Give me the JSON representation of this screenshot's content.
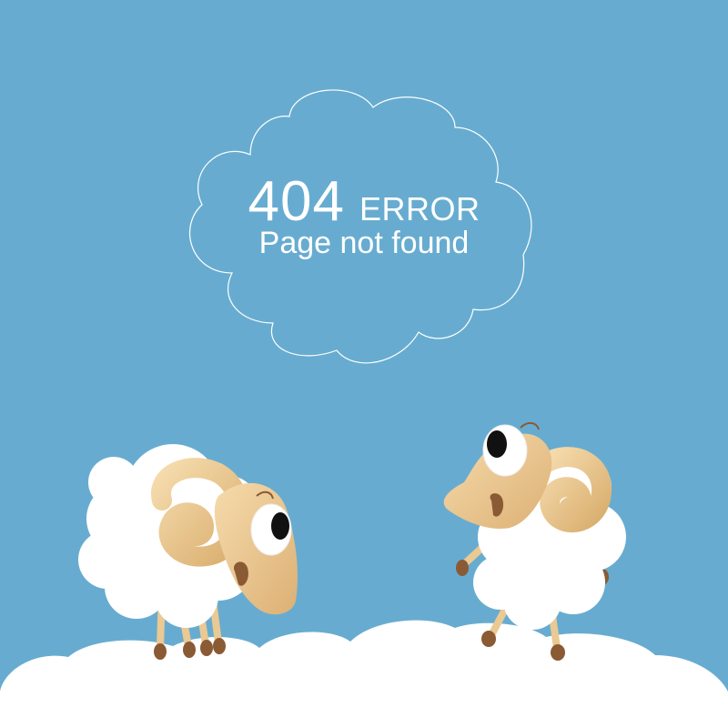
{
  "error": {
    "code": "404",
    "word": "ERROR",
    "message": "Page not found"
  },
  "colors": {
    "sky": "#67acd0",
    "cloud": "#ffffff",
    "horn": "#eac993",
    "hoof": "#8a5a35"
  },
  "icons": [
    "speech-cloud-icon",
    "sheep-illustration",
    "ground-cloud-illustration"
  ]
}
